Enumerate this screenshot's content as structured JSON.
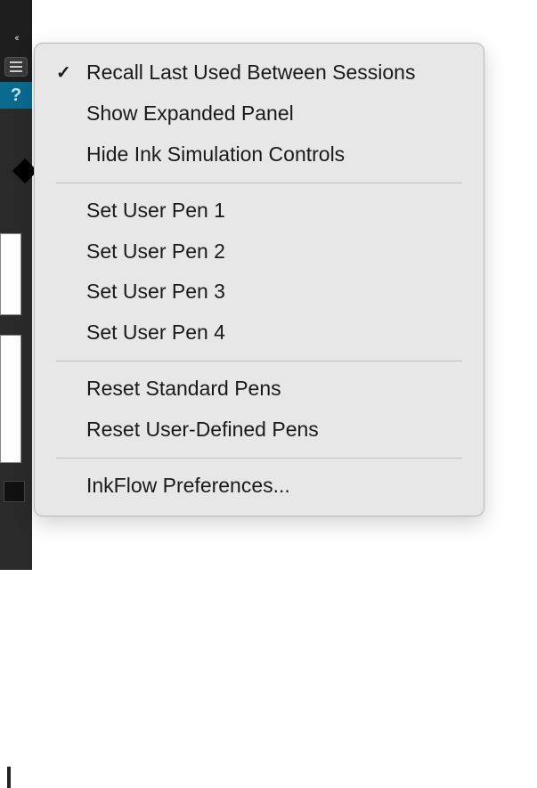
{
  "sidebar": {
    "collapse_glyph": "‹‹",
    "help_glyph": "?"
  },
  "menu": {
    "items": [
      {
        "label": "Recall Last Used Between Sessions",
        "checked": true
      },
      {
        "label": "Show Expanded Panel",
        "checked": false
      },
      {
        "label": "Hide Ink Simulation Controls",
        "checked": false
      },
      {
        "sep": true
      },
      {
        "label": "Set User Pen 1",
        "checked": false
      },
      {
        "label": "Set User Pen 2",
        "checked": false
      },
      {
        "label": "Set User Pen 3",
        "checked": false
      },
      {
        "label": "Set User Pen 4",
        "checked": false
      },
      {
        "sep": true
      },
      {
        "label": "Reset Standard Pens",
        "checked": false
      },
      {
        "label": "Reset User-Defined Pens",
        "checked": false
      },
      {
        "sep": true
      },
      {
        "label": "InkFlow Preferences...",
        "checked": false
      }
    ],
    "check_glyph": "✓"
  }
}
